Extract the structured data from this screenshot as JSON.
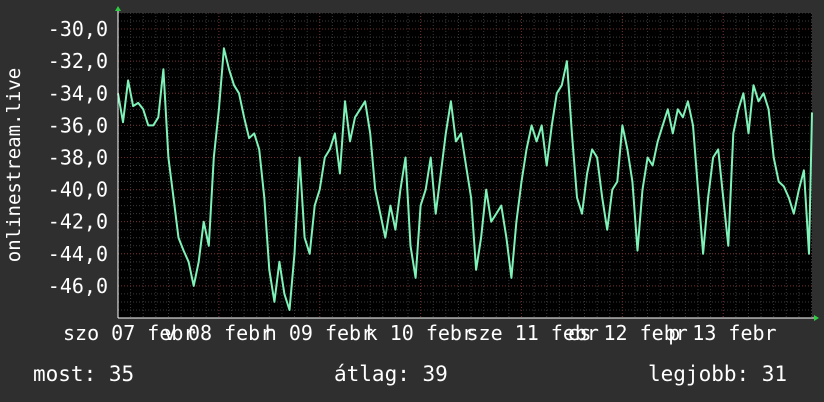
{
  "chart_data": {
    "type": "line",
    "ylabel": "onlinestream.live",
    "yticks": [
      "-30,0",
      "-32,0",
      "-34,0",
      "-36,0",
      "-38,0",
      "-40,0",
      "-42,0",
      "-44,0",
      "-46,0"
    ],
    "ytick_values": [
      -30,
      -32,
      -34,
      -36,
      -38,
      -40,
      -42,
      -44,
      -46
    ],
    "xticks": [
      "szo 07 febr",
      "v 08 febr",
      "h 09 febr",
      "k 10 febr",
      "sze 11 febr",
      "cs 12 febr",
      "p 13 febr"
    ],
    "xtick_days": [
      7,
      8,
      9,
      10,
      11,
      12,
      13
    ],
    "xlim_days": [
      7,
      13.88
    ],
    "ylim": [
      -48,
      -29
    ],
    "grid": true,
    "colors": {
      "line": "#7ef2b8",
      "background": "#000000",
      "grid": "#6e2a2a",
      "axis": "#ffffff",
      "arrow": "#2ecc40"
    },
    "series": [
      {
        "x": [
          7.0,
          7.05,
          7.1,
          7.15,
          7.2,
          7.25,
          7.3,
          7.35,
          7.4,
          7.45,
          7.5,
          7.55,
          7.6,
          7.65,
          7.7,
          7.75,
          7.8,
          7.85,
          7.9,
          7.95,
          8.0,
          8.05,
          8.1,
          8.15,
          8.2,
          8.25,
          8.3,
          8.35,
          8.4,
          8.45,
          8.5,
          8.55,
          8.6,
          8.65,
          8.7,
          8.75,
          8.8,
          8.85,
          8.9,
          8.95,
          9.0,
          9.05,
          9.1,
          9.15,
          9.2,
          9.25,
          9.3,
          9.35,
          9.4,
          9.45,
          9.5,
          9.55,
          9.6,
          9.65,
          9.7,
          9.75,
          9.8,
          9.85,
          9.9,
          9.95,
          10.0,
          10.05,
          10.1,
          10.15,
          10.2,
          10.25,
          10.3,
          10.35,
          10.4,
          10.45,
          10.5,
          10.55,
          10.6,
          10.65,
          10.7,
          10.75,
          10.8,
          10.85,
          10.9,
          10.95,
          11.0,
          11.05,
          11.1,
          11.15,
          11.2,
          11.25,
          11.3,
          11.35,
          11.4,
          11.45,
          11.5,
          11.55,
          11.6,
          11.65,
          11.7,
          11.75,
          11.8,
          11.85,
          11.9,
          11.95,
          12.0,
          12.05,
          12.1,
          12.15,
          12.2,
          12.25,
          12.3,
          12.35,
          12.4,
          12.45,
          12.5,
          12.55,
          12.6,
          12.65,
          12.7,
          12.75,
          12.8,
          12.85,
          12.9,
          12.95,
          13.0,
          13.05,
          13.1,
          13.15,
          13.2,
          13.25,
          13.3,
          13.35,
          13.4,
          13.45,
          13.5,
          13.55,
          13.6,
          13.65,
          13.7,
          13.75,
          13.8,
          13.85,
          13.88
        ],
        "y": [
          -34.0,
          -35.8,
          -33.2,
          -34.8,
          -34.6,
          -35.0,
          -36.0,
          -36.0,
          -35.5,
          -32.5,
          -38.0,
          -40.5,
          -43.0,
          -43.8,
          -44.5,
          -46.0,
          -44.5,
          -42.0,
          -43.5,
          -38.0,
          -35.0,
          -31.2,
          -32.5,
          -33.5,
          -34.0,
          -35.5,
          -36.8,
          -36.5,
          -37.5,
          -40.5,
          -45.0,
          -47.0,
          -44.5,
          -46.5,
          -47.5,
          -44.0,
          -38.0,
          -43.0,
          -44.0,
          -41.0,
          -40.0,
          -38.0,
          -37.5,
          -36.5,
          -39.0,
          -34.5,
          -37.0,
          -35.5,
          -35.0,
          -34.5,
          -36.5,
          -40.0,
          -41.5,
          -43.0,
          -41.0,
          -42.5,
          -40.0,
          -38.0,
          -43.5,
          -45.5,
          -41.0,
          -40.0,
          -38.0,
          -41.5,
          -39.0,
          -36.5,
          -34.5,
          -37.0,
          -36.5,
          -38.5,
          -40.5,
          -45.0,
          -43.0,
          -40.0,
          -42.0,
          -41.5,
          -41.0,
          -43.0,
          -45.5,
          -42.0,
          -39.5,
          -37.5,
          -36.0,
          -37.0,
          -36.0,
          -38.5,
          -36.0,
          -34.0,
          -33.5,
          -32.0,
          -36.5,
          -40.5,
          -41.5,
          -39.0,
          -37.5,
          -38.0,
          -40.5,
          -42.5,
          -40.0,
          -39.5,
          -36.0,
          -37.5,
          -39.5,
          -43.8,
          -40.0,
          -38.0,
          -38.5,
          -37.0,
          -36.0,
          -35.0,
          -36.5,
          -35.0,
          -35.5,
          -34.5,
          -36.0,
          -40.0,
          -44.0,
          -40.5,
          -38.0,
          -37.5,
          -40.5,
          -43.5,
          -36.5,
          -35.0,
          -34.0,
          -36.5,
          -33.5,
          -34.5,
          -34.0,
          -35.0,
          -38.0,
          -39.5,
          -39.8,
          -40.5,
          -41.5,
          -40.0,
          -38.8,
          -44.0,
          -35.2
        ]
      }
    ],
    "rrd_arrow": "▸"
  },
  "footer": {
    "current": "most: 35",
    "average": "átlag: 39",
    "max": "legjobb: 31"
  }
}
